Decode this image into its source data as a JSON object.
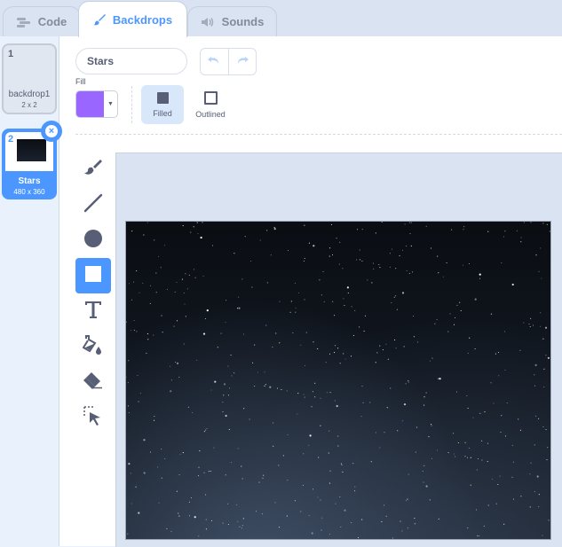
{
  "tabs": [
    {
      "label": "Code",
      "icon": "code-icon"
    },
    {
      "label": "Backdrops",
      "icon": "paintbrush-icon"
    },
    {
      "label": "Sounds",
      "icon": "speaker-icon"
    }
  ],
  "backdrops": [
    {
      "number": "1",
      "name": "backdrop1",
      "size": "2 x 2"
    },
    {
      "number": "2",
      "name": "Stars",
      "size": "480 x 360"
    }
  ],
  "editor": {
    "costume_name": "Stars",
    "fill_label": "Fill",
    "fill_color": "#9966ff",
    "modes": {
      "filled": "Filled",
      "outlined": "Outlined"
    },
    "tools": [
      "brush-tool",
      "line-tool",
      "circle-tool",
      "rectangle-tool",
      "text-tool",
      "fill-tool",
      "eraser-tool",
      "select-tool"
    ],
    "active_tool": "rectangle-tool"
  },
  "colors": {
    "accent": "#4c97ff",
    "text": "#575e75",
    "fill": "#9966ff"
  }
}
